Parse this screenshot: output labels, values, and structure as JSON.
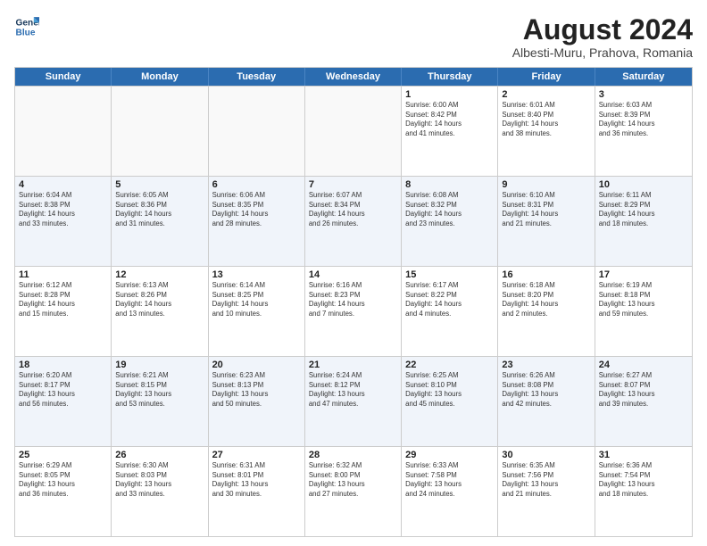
{
  "logo": {
    "text_line1": "General",
    "text_line2": "Blue"
  },
  "title": {
    "month_year": "August 2024",
    "location": "Albesti-Muru, Prahova, Romania"
  },
  "header_days": [
    "Sunday",
    "Monday",
    "Tuesday",
    "Wednesday",
    "Thursday",
    "Friday",
    "Saturday"
  ],
  "weeks": [
    [
      {
        "day": "",
        "info": ""
      },
      {
        "day": "",
        "info": ""
      },
      {
        "day": "",
        "info": ""
      },
      {
        "day": "",
        "info": ""
      },
      {
        "day": "1",
        "info": "Sunrise: 6:00 AM\nSunset: 8:42 PM\nDaylight: 14 hours\nand 41 minutes."
      },
      {
        "day": "2",
        "info": "Sunrise: 6:01 AM\nSunset: 8:40 PM\nDaylight: 14 hours\nand 38 minutes."
      },
      {
        "day": "3",
        "info": "Sunrise: 6:03 AM\nSunset: 8:39 PM\nDaylight: 14 hours\nand 36 minutes."
      }
    ],
    [
      {
        "day": "4",
        "info": "Sunrise: 6:04 AM\nSunset: 8:38 PM\nDaylight: 14 hours\nand 33 minutes."
      },
      {
        "day": "5",
        "info": "Sunrise: 6:05 AM\nSunset: 8:36 PM\nDaylight: 14 hours\nand 31 minutes."
      },
      {
        "day": "6",
        "info": "Sunrise: 6:06 AM\nSunset: 8:35 PM\nDaylight: 14 hours\nand 28 minutes."
      },
      {
        "day": "7",
        "info": "Sunrise: 6:07 AM\nSunset: 8:34 PM\nDaylight: 14 hours\nand 26 minutes."
      },
      {
        "day": "8",
        "info": "Sunrise: 6:08 AM\nSunset: 8:32 PM\nDaylight: 14 hours\nand 23 minutes."
      },
      {
        "day": "9",
        "info": "Sunrise: 6:10 AM\nSunset: 8:31 PM\nDaylight: 14 hours\nand 21 minutes."
      },
      {
        "day": "10",
        "info": "Sunrise: 6:11 AM\nSunset: 8:29 PM\nDaylight: 14 hours\nand 18 minutes."
      }
    ],
    [
      {
        "day": "11",
        "info": "Sunrise: 6:12 AM\nSunset: 8:28 PM\nDaylight: 14 hours\nand 15 minutes."
      },
      {
        "day": "12",
        "info": "Sunrise: 6:13 AM\nSunset: 8:26 PM\nDaylight: 14 hours\nand 13 minutes."
      },
      {
        "day": "13",
        "info": "Sunrise: 6:14 AM\nSunset: 8:25 PM\nDaylight: 14 hours\nand 10 minutes."
      },
      {
        "day": "14",
        "info": "Sunrise: 6:16 AM\nSunset: 8:23 PM\nDaylight: 14 hours\nand 7 minutes."
      },
      {
        "day": "15",
        "info": "Sunrise: 6:17 AM\nSunset: 8:22 PM\nDaylight: 14 hours\nand 4 minutes."
      },
      {
        "day": "16",
        "info": "Sunrise: 6:18 AM\nSunset: 8:20 PM\nDaylight: 14 hours\nand 2 minutes."
      },
      {
        "day": "17",
        "info": "Sunrise: 6:19 AM\nSunset: 8:18 PM\nDaylight: 13 hours\nand 59 minutes."
      }
    ],
    [
      {
        "day": "18",
        "info": "Sunrise: 6:20 AM\nSunset: 8:17 PM\nDaylight: 13 hours\nand 56 minutes."
      },
      {
        "day": "19",
        "info": "Sunrise: 6:21 AM\nSunset: 8:15 PM\nDaylight: 13 hours\nand 53 minutes."
      },
      {
        "day": "20",
        "info": "Sunrise: 6:23 AM\nSunset: 8:13 PM\nDaylight: 13 hours\nand 50 minutes."
      },
      {
        "day": "21",
        "info": "Sunrise: 6:24 AM\nSunset: 8:12 PM\nDaylight: 13 hours\nand 47 minutes."
      },
      {
        "day": "22",
        "info": "Sunrise: 6:25 AM\nSunset: 8:10 PM\nDaylight: 13 hours\nand 45 minutes."
      },
      {
        "day": "23",
        "info": "Sunrise: 6:26 AM\nSunset: 8:08 PM\nDaylight: 13 hours\nand 42 minutes."
      },
      {
        "day": "24",
        "info": "Sunrise: 6:27 AM\nSunset: 8:07 PM\nDaylight: 13 hours\nand 39 minutes."
      }
    ],
    [
      {
        "day": "25",
        "info": "Sunrise: 6:29 AM\nSunset: 8:05 PM\nDaylight: 13 hours\nand 36 minutes."
      },
      {
        "day": "26",
        "info": "Sunrise: 6:30 AM\nSunset: 8:03 PM\nDaylight: 13 hours\nand 33 minutes."
      },
      {
        "day": "27",
        "info": "Sunrise: 6:31 AM\nSunset: 8:01 PM\nDaylight: 13 hours\nand 30 minutes."
      },
      {
        "day": "28",
        "info": "Sunrise: 6:32 AM\nSunset: 8:00 PM\nDaylight: 13 hours\nand 27 minutes."
      },
      {
        "day": "29",
        "info": "Sunrise: 6:33 AM\nSunset: 7:58 PM\nDaylight: 13 hours\nand 24 minutes."
      },
      {
        "day": "30",
        "info": "Sunrise: 6:35 AM\nSunset: 7:56 PM\nDaylight: 13 hours\nand 21 minutes."
      },
      {
        "day": "31",
        "info": "Sunrise: 6:36 AM\nSunset: 7:54 PM\nDaylight: 13 hours\nand 18 minutes."
      }
    ]
  ]
}
